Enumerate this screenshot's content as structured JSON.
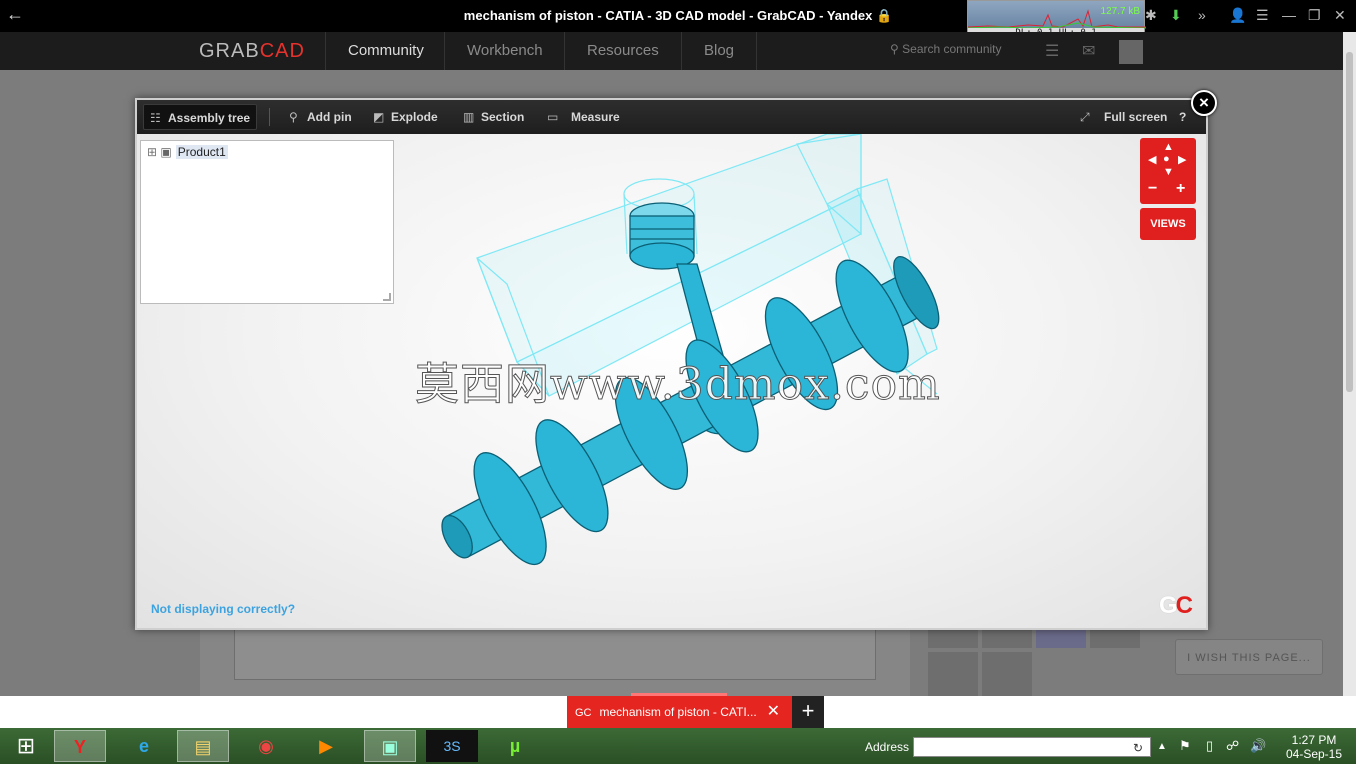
{
  "browser": {
    "title": "mechanism of piston - CATIA - 3D CAD model - GrabCAD - Yandex",
    "lock_icon": "lock-icon",
    "net_meter": {
      "speed": "127.7 kB",
      "stats": "DL: 0.1 UL: 0.1"
    }
  },
  "site_nav": {
    "logo_grab": "GRAB",
    "logo_cad": "CAD",
    "items": [
      {
        "label": "Community"
      },
      {
        "label": "Workbench"
      },
      {
        "label": "Resources"
      },
      {
        "label": "Blog"
      }
    ],
    "search_placeholder": "Search community"
  },
  "background": {
    "wish_label": "I WISH THIS PAGE..."
  },
  "viewer": {
    "toolbar": {
      "assembly_tree": "Assembly tree",
      "add_pin": "Add pin",
      "explode": "Explode",
      "section": "Section",
      "measure": "Measure",
      "full_screen": "Full screen",
      "help": "?"
    },
    "tree": {
      "expander": "⊞",
      "root_label": "Product1"
    },
    "views_label": "VIEWS",
    "not_displaying": "Not displaying correctly?",
    "logo_g": "G",
    "logo_c": "C",
    "watermark": "莫西网www.3dmox.com",
    "close": "×",
    "colors": {
      "accent": "#e0201f",
      "model": "#2bb5d6",
      "wire": "#7fe8f5"
    }
  },
  "tabbar": {
    "active_tab_prefix": "GC",
    "active_tab_label": "mechanism of piston - CATI...",
    "close": "✕",
    "new_tab": "+"
  },
  "taskbar": {
    "address_label": "Address",
    "address_value": "",
    "time": "1:27 PM",
    "date": "04-Sep-15"
  }
}
